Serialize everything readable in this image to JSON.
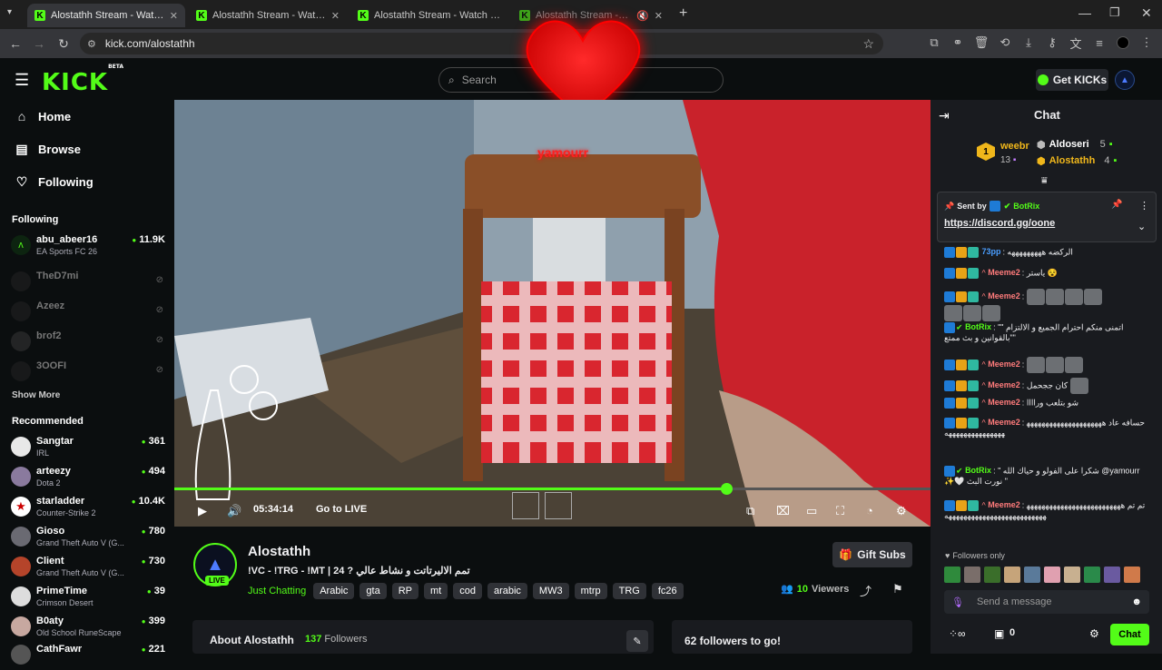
{
  "browser": {
    "tabs": [
      {
        "title": "Alostathh Stream - Watch Live on Kick",
        "active": true
      },
      {
        "title": "Alostathh Stream - Watch Live on Kick",
        "active": false
      },
      {
        "title": "Alostathh Stream - Watch Live on Kick",
        "active": false
      },
      {
        "title": "Alostathh Stream - Watch Live on Kick",
        "active": false
      }
    ],
    "url": "kick.com/alostathh"
  },
  "header": {
    "logo": "KICK",
    "logo_badge": "BETA",
    "search_placeholder": "Search",
    "get_kicks_label": "Get KICKs"
  },
  "sidebar": {
    "nav": [
      {
        "label": "Home",
        "icon": "home-icon"
      },
      {
        "label": "Browse",
        "icon": "browse-icon"
      },
      {
        "label": "Following",
        "icon": "heart-icon"
      }
    ],
    "following_heading": "Following",
    "following": [
      {
        "name": "abu_abeer16",
        "category": "EA Sports FC 26",
        "viewers": "11.9K",
        "live": true
      },
      {
        "name": "TheD7mi",
        "live": false
      },
      {
        "name": "Azeez",
        "live": false
      },
      {
        "name": "brof2",
        "live": false
      },
      {
        "name": "3OOFI",
        "live": false
      }
    ],
    "show_more": "Show More",
    "recommended_heading": "Recommended",
    "recommended": [
      {
        "name": "Sangtar",
        "category": "IRL",
        "viewers": "361"
      },
      {
        "name": "arteezy",
        "category": "Dota 2",
        "viewers": "494"
      },
      {
        "name": "starladder",
        "category": "Counter-Strike 2",
        "viewers": "10.4K"
      },
      {
        "name": "Gioso",
        "category": "Grand Theft Auto V (G...",
        "viewers": "780"
      },
      {
        "name": "Client",
        "category": "Grand Theft Auto V (G...",
        "viewers": "730"
      },
      {
        "name": "PrimeTime",
        "category": "Crimson Desert",
        "viewers": "39"
      },
      {
        "name": "B0aty",
        "category": "Old School RuneScape",
        "viewers": "399"
      },
      {
        "name": "CathFawr",
        "category": "",
        "viewers": "221"
      }
    ]
  },
  "video": {
    "overlay_name": "yamourr",
    "time": "05:34:14",
    "go_live": "Go to LIVE",
    "progress": 0.73
  },
  "channel": {
    "name": "Alostathh",
    "live_badge": "LIVE",
    "title": "!VC - !TRG - !MT | 24 ? تمم الاليرتاتت و نشاط عالي",
    "category": "Just Chatting",
    "tags": [
      "Arabic",
      "gta",
      "RP",
      "mt",
      "cod",
      "arabic",
      "MW3",
      "mtrp",
      "TRG",
      "fc26"
    ],
    "viewers_count": "10",
    "viewers_label": "Viewers",
    "gift_subs_label": "Gift Subs",
    "about_label": "About Alostathh",
    "followers_count": "137",
    "followers_label": "Followers",
    "followers_goal": "62 followers to go!"
  },
  "chat": {
    "header": "Chat",
    "leaderboard": [
      {
        "rank": "1",
        "name": "weebr",
        "count": "13"
      },
      {
        "name": "Aldoseri",
        "count": "5"
      },
      {
        "name": "Alostathh",
        "count": "4"
      }
    ],
    "pinned": {
      "sent_by_label": "Sent by",
      "sender": "BotRix",
      "link": "https://discord.gg/oone"
    },
    "messages": [
      {
        "user": "73pp",
        "text": "الركضه هههههههههه",
        "color": "#4a9eff"
      },
      {
        "user": "Meeme2",
        "text": "ياستر 😵",
        "color": "#ff7b7b"
      },
      {
        "user": "Meeme2",
        "text": "",
        "color": "#ff7b7b"
      },
      {
        "user": "BotRix",
        "text": "\"\" اتمنى منكم احترام الجميع و الالتزام بالقوانين و بث ممتع\"\"",
        "color": "#53fc18"
      },
      {
        "user": "Meeme2",
        "text": "",
        "color": "#ff7b7b"
      },
      {
        "user": "Meeme2",
        "text": "كان ججحمل",
        "color": "#ff7b7b"
      },
      {
        "user": "Meeme2",
        "text": "شو بتلعب وراااا",
        "color": "#ff7b7b"
      },
      {
        "user": "Meeme2",
        "text": "حسافه عاد ههههههههههههههههههههههههههههههههههههه",
        "color": "#ff7b7b"
      },
      {
        "user": "BotRix",
        "text": "\" شكرا على الفولو و حياك الله @yamourr ✨🤍 نورت البث \"",
        "color": "#53fc18"
      },
      {
        "user": "Meeme2",
        "text": "تم تم ههههههههههههههههههههههههههههههههههههههههههههههههههههه",
        "color": "#ff7b7b"
      }
    ],
    "followers_only": "Followers only",
    "input_placeholder": "Send a message",
    "kicks_count": "0",
    "chat_button": "Chat"
  }
}
